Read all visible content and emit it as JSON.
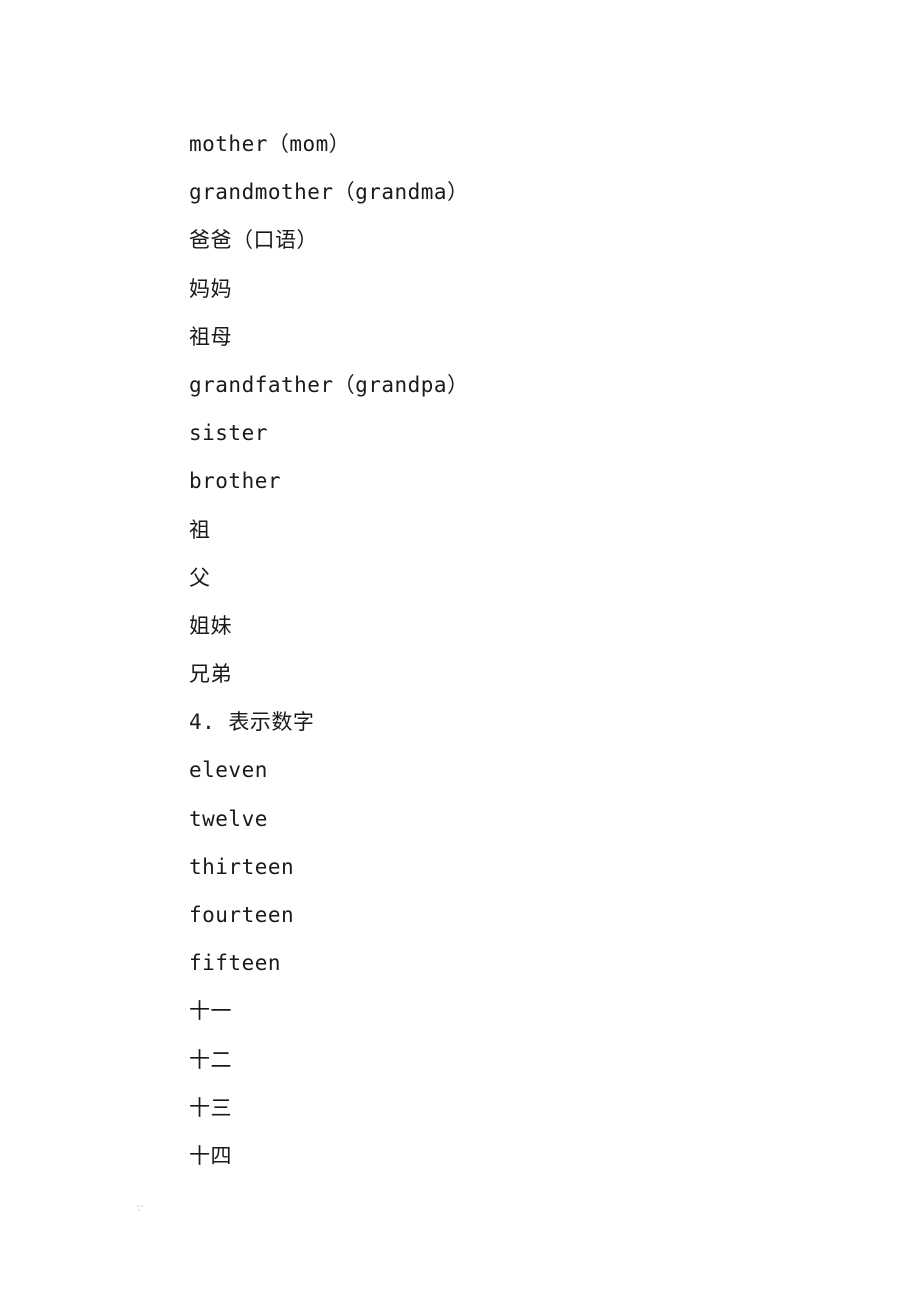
{
  "document": {
    "lines": [
      "mother（mom）",
      "grandmother（grandma）",
      "爸爸（口语）",
      "妈妈",
      "祖母",
      "grandfather（grandpa）",
      "sister",
      "brother",
      "祖",
      "父",
      "姐妹",
      "兄弟",
      "4. 表示数字",
      "eleven",
      "twelve",
      "thirteen",
      "fourteen",
      "fifteen",
      "十一",
      "十二",
      "十三",
      "十四"
    ]
  }
}
